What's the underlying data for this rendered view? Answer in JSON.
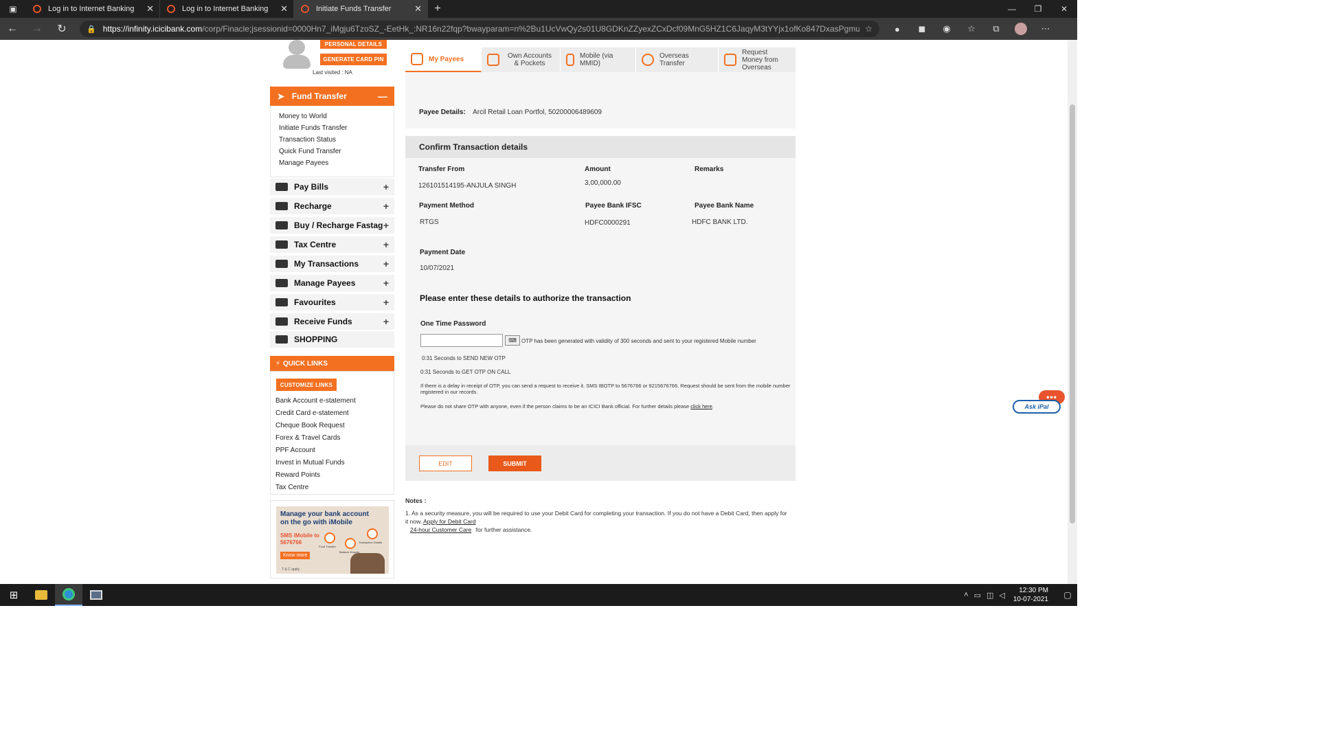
{
  "browser": {
    "tabs": [
      {
        "title": "Log in to Internet Banking",
        "active": false
      },
      {
        "title": "Log in to Internet Banking",
        "active": false
      },
      {
        "title": "Initiate Funds Transfer",
        "active": true
      }
    ],
    "url_host": "https://infinity.icicibank.com",
    "url_rest": "/corp/Finacle;jsessionid=0000Hn7_iMgju6TzoSZ_-EetHk_:NR16n22fqp?bwayparam=n%2Bu1UcVwQy2s01U8GDKnZZyexZCxDcf09MnG5HZ1C6JaqyM3tYYjx1ofKo847DxasPgmu4YCquCT%0D..."
  },
  "sidebar": {
    "personal_details_btn": "PERSONAL DETAILS",
    "generate_pin_btn": "GENERATE CARD PIN",
    "last_visited": "Last visited : NA",
    "fund_transfer": {
      "title": "Fund Transfer",
      "items": [
        "Money to World",
        "Initiate Funds Transfer",
        "Transaction Status",
        "Quick Fund Transfer",
        "Manage Payees"
      ]
    },
    "menu": [
      {
        "label": "Pay Bills",
        "icon": "bill-icon"
      },
      {
        "label": "Recharge",
        "icon": "recharge-icon"
      },
      {
        "label": "Buy / Recharge Fastag",
        "icon": "fastag-icon"
      },
      {
        "label": "Tax Centre",
        "icon": "bank-icon"
      },
      {
        "label": "My Transactions",
        "icon": "transfer-arrows-icon"
      },
      {
        "label": "Manage Payees",
        "icon": "users-icon"
      },
      {
        "label": "Favourites",
        "icon": "bookmark-star-icon"
      },
      {
        "label": "Receive Funds",
        "icon": "envelope-icon"
      },
      {
        "label": "SHOPPING",
        "icon": "shopping-icon"
      }
    ],
    "quick_links": {
      "title": "QUICK LINKS",
      "customize_btn": "CUSTOMIZE LINKS",
      "items": [
        "Bank Account e-statement",
        "Credit Card e-statement",
        "Cheque Book Request",
        "Forex & Travel Cards",
        "PPF Account",
        "Invest in Mutual Funds",
        "Reward Points",
        "Tax Centre"
      ]
    },
    "banner": {
      "title": "Manage your bank account on the go with iMobile",
      "sms": "SMS iMobile to 5676766",
      "know_more": "Know more",
      "fund_transfer": "Fund Transfer",
      "balance_enquiry": "Balance Enquiry",
      "transaction_details": "Transaction Details",
      "tc": "T & C apply"
    }
  },
  "payee_tabs": [
    {
      "label": "My Payees",
      "active": true
    },
    {
      "label": "Own Accounts & Pockets",
      "active": false
    },
    {
      "label": "Mobile (via MMID)",
      "active": false
    },
    {
      "label": "Overseas Transfer",
      "active": false
    },
    {
      "label": "Request Money from Overseas",
      "active": false
    }
  ],
  "payee_details": {
    "label": "Payee Details:",
    "value": "Arcil Retail Loan Portfol, 50200006489609"
  },
  "confirm": {
    "title": "Confirm Transaction details",
    "transfer_from_label": "Transfer From",
    "transfer_from_value": "126101514195-ANJULA SINGH",
    "amount_label": "Amount",
    "amount_value": "3,00,000.00",
    "remarks_label": "Remarks",
    "payment_method_label": "Payment Method",
    "payment_method_value": "RTGS",
    "ifsc_label": "Payee Bank IFSC",
    "ifsc_value": "HDFC0000291",
    "bank_name_label": "Payee Bank Name",
    "bank_name_value": "HDFC BANK LTD.",
    "payment_date_label": "Payment Date",
    "payment_date_value": "10/07/2021"
  },
  "auth": {
    "title": "Please enter these details to authorize the transaction",
    "otp_label": "One Time Password",
    "otp_value": "",
    "otp_msg": "OTP has been generated with validity of 300 seconds and sent to your registered Mobile number",
    "send_new_otp": "0:31 Seconds to SEND NEW OTP",
    "otp_on_call": "0:31 Seconds to GET OTP ON CALL",
    "delay_msg": "If there is a delay in receipt of OTP, you can send a request to receive it. SMS IBOTP to 5676766 or 9215676766. Request should be sent from the mobile number registered in our records.",
    "share_msg": "Please do not share OTP with anyone, even if the person claims to be an ICICI Bank official. For further details please",
    "click_here": "click here",
    "period": "."
  },
  "buttons": {
    "edit": "EDIT",
    "submit": "SUBMIT"
  },
  "notes": {
    "title": "Notes :",
    "note1": "1. As a security measure, you will be required to use your Debit Card for completing your transaction. If you do not have a Debit Card, then apply for it now.",
    "apply_link": "Apply for Debit Card",
    "care_link": "24-hour Customer Care",
    "care_suffix": "for further assistance."
  },
  "askipal": {
    "label": "Ask iPal",
    "dots": "•••"
  },
  "taskbar": {
    "time": "12:30 PM",
    "date": "10-07-2021"
  },
  "colors": {
    "brand_orange": "#f37021",
    "brand_blue": "#1d5fa8"
  }
}
